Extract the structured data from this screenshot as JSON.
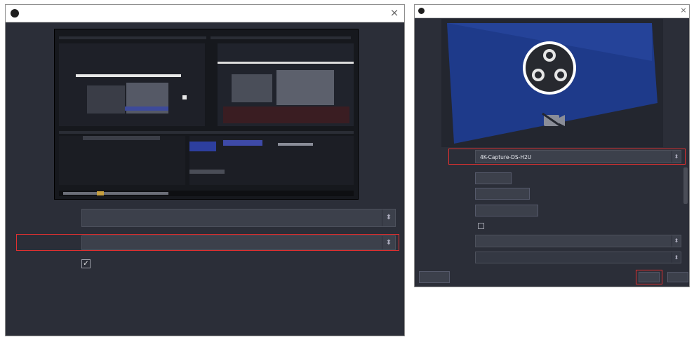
{
  "left_dialog": {
    "title": "",
    "close_glyph": "×",
    "capture_method_label": "",
    "capture_method_value": "",
    "display_label": "",
    "display_value": "",
    "capture_cursor_label": "",
    "capture_cursor_checked": true,
    "spin_glyph": "⬍"
  },
  "right_dialog": {
    "title": "",
    "close_glyph": "×",
    "device_label": "",
    "device_value": "4K-Capture-DS-H2U",
    "buttons": [
      "",
      "",
      ""
    ],
    "deactivate_label": "",
    "resolution_label": "",
    "resolution_value": "",
    "resolution2_label": "",
    "resolution2_value": "",
    "defaults_button": "",
    "ok_button": "",
    "cancel_button": "",
    "spin_glyph": "⬍"
  },
  "colors": {
    "highlight": "#e03030",
    "dialog_bg": "#2b2e38",
    "field_bg": "#3c404b",
    "preview_blue": "#1e3a8a"
  }
}
